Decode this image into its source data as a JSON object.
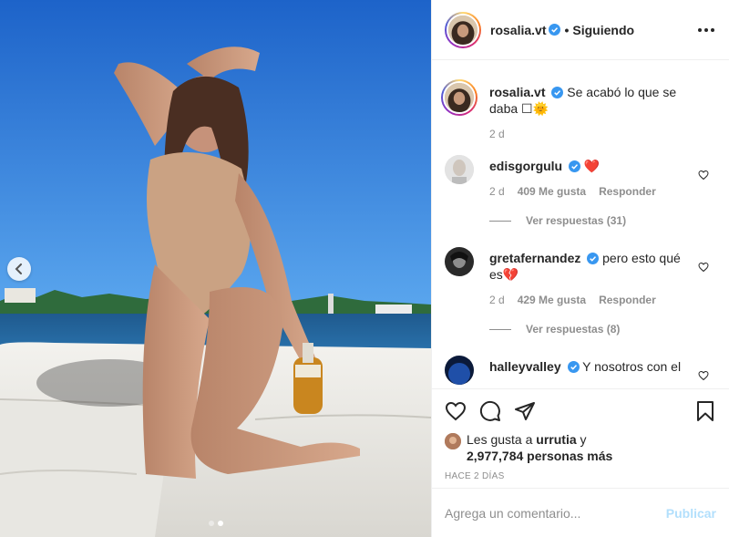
{
  "post": {
    "author": {
      "username": "rosalia.vt",
      "verified": true
    },
    "follow_separator": "•",
    "follow_status": "Siguiendo",
    "more_icon": "more-options-icon"
  },
  "caption": {
    "username": "rosalia.vt",
    "text": "Se acabó lo que se daba",
    "emoji": "☐🌞",
    "time": "2 d"
  },
  "comments": [
    {
      "username": "edisgorgulu",
      "text": "❤️",
      "time": "2 d",
      "likes": "409 Me gusta",
      "reply": "Responder",
      "view_replies": "Ver respuestas (31)"
    },
    {
      "username": "gretafernandez",
      "text": "pero esto qué es💔",
      "time": "2 d",
      "likes": "429 Me gusta",
      "reply": "Responder",
      "view_replies": "Ver respuestas (8)"
    },
    {
      "username": "halleyvalley",
      "text": "Y nosotros con el"
    }
  ],
  "likes": {
    "prefix": "Les gusta a",
    "user": "urrutia",
    "conj": "y",
    "count": "2,977,784 personas más"
  },
  "time_ago": "HACE 2 DÍAS",
  "add_comment": {
    "placeholder": "Agrega un comentario...",
    "publish_label": "Publicar"
  },
  "carousel": {
    "slide_count": 2,
    "active_index": 1
  },
  "colors": {
    "link_disabled": "#b2dffc",
    "muted": "#8e8e8e",
    "verified": "#3897f0",
    "heart": "#ed4956"
  }
}
